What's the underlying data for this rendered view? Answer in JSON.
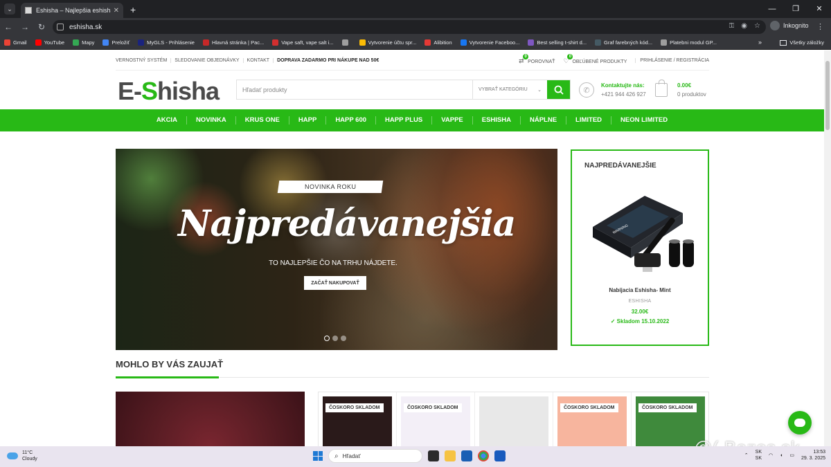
{
  "browser": {
    "tab_title": "Eshisha – Najlepšia eshisha na t",
    "url": "eshisha.sk",
    "incognito_label": "Inkognito",
    "bookmarks": [
      {
        "label": "Gmail",
        "color": "#ea4335"
      },
      {
        "label": "YouTube",
        "color": "#ff0000"
      },
      {
        "label": "Mapy",
        "color": "#34a853"
      },
      {
        "label": "Preložiť",
        "color": "#4285f4"
      },
      {
        "label": "MyGLS - Prihlásenie",
        "color": "#1a237e"
      },
      {
        "label": "Hlavná stránka | Pac...",
        "color": "#c62828"
      },
      {
        "label": "Vape saft, vape salt i...",
        "color": "#d32f2f"
      },
      {
        "label": "",
        "color": "#9e9e9e"
      },
      {
        "label": "Vytvorenie účtu spr...",
        "color": "#fbbc05"
      },
      {
        "label": "Alibition",
        "color": "#e53935"
      },
      {
        "label": "Vytvorenie Faceboo...",
        "color": "#1877f2"
      },
      {
        "label": "Best selling t-shirt d...",
        "color": "#7e57c2"
      },
      {
        "label": "Graf farebných kód...",
        "color": "#455a64"
      },
      {
        "label": "Platebni modul GP...",
        "color": "#9e9e9e"
      }
    ],
    "all_bookmarks_label": "Všetky záložky"
  },
  "site": {
    "topbar_links": [
      "VERNOSTNÝ SYSTÉM",
      "SLEDOVANIE OBJEDNÁVKY",
      "KONTAKT"
    ],
    "shipping_note": "DOPRAVA ZADARMO PRI NÁKUPE NAD 50€",
    "compare": {
      "label": "POROVNAŤ",
      "count": "0"
    },
    "favorites": {
      "label": "OBĽÚBENÉ PRODUKTY",
      "count": "0"
    },
    "login": "PRIHLÁSENIE / REGISTRÁCIA",
    "logo": {
      "a": "E-",
      "s": "S",
      "b": "hisha"
    },
    "search_placeholder": "Hľadať produkty",
    "category_select": "VYBRAŤ KATEGÓRIU",
    "contact_title": "Kontaktujte nás:",
    "contact_phone": "+421 944 426 927",
    "cart_total": "0.00€",
    "cart_count": "0 produktov",
    "nav": [
      "AKCIA",
      "NOVINKA",
      "KRUS ONE",
      "HAPP",
      "HAPP 600",
      "HAPP PLUS",
      "VAPPE",
      "ESHISHA",
      "NÁPLNE",
      "LIMITED",
      "NEON LIMITED"
    ],
    "accent": "#28b916"
  },
  "hero": {
    "badge": "NOVINKA ROKU",
    "headline": "Najpredávanejšia",
    "subtitle": "TO NAJLEPŠIE ČO NA TRHU NÁJDETE.",
    "cta": "ZAČAŤ NAKUPOVAŤ",
    "slides": 3,
    "active_slide": 1
  },
  "bestseller": {
    "heading": "NAJPREDÁVANEJŠIE",
    "product_name": "Nabíjacia Eshisha- Mint",
    "brand": "ESHISHA",
    "price": "32.00€",
    "stock": "Skladom 15.10.2022"
  },
  "section": {
    "heading": "MOHLO BY VÁS ZAUJAŤ",
    "products": [
      {
        "label": "ČOSKORO SKLADOM",
        "color": "#2a1a1a"
      },
      {
        "label": "ČOSKORO SKLADOM",
        "color": "#f3eff7"
      },
      {
        "label": "",
        "color": "#e8e8e8"
      },
      {
        "label": "ČOSKORO SKLADOM",
        "color": "#f7b59e"
      },
      {
        "label": "ČOSKORO SKLADOM",
        "color": "#3f8a3c"
      }
    ]
  },
  "watermark": "@( Bazos.sk",
  "taskbar": {
    "temp": "11°C",
    "weather": "Cloudy",
    "search": "Hľadať",
    "lang1": "SK",
    "lang2": "SK",
    "time": "13:53",
    "date": "29. 3. 2025"
  }
}
